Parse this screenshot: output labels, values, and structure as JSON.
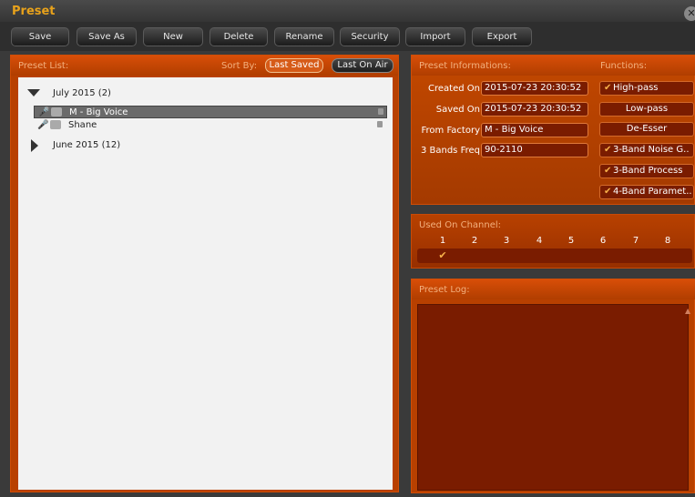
{
  "window": {
    "title": "Preset"
  },
  "toolbar": {
    "buttons": [
      "Save",
      "Save As",
      "New",
      "Delete",
      "Rename",
      "Security",
      "Import",
      "Export"
    ]
  },
  "preset_list": {
    "label": "Preset List:",
    "sort_label": "Sort By:",
    "sort_options": [
      "Last Saved",
      "Last On Air"
    ],
    "groups": [
      {
        "label": "July 2015 (2)",
        "expanded": true,
        "items": [
          {
            "name": "M - Big Voice",
            "selected": true
          },
          {
            "name": "Shane",
            "selected": false
          }
        ]
      },
      {
        "label": "June 2015 (12)",
        "expanded": false,
        "items": []
      }
    ]
  },
  "info": {
    "label": "Preset Informations:",
    "fields": [
      {
        "label": "Created On",
        "value": "2015-07-23 20:30:52"
      },
      {
        "label": "Saved On",
        "value": "2015-07-23 20:30:52"
      },
      {
        "label": "From Factory",
        "value": "M - Big Voice"
      },
      {
        "label": "3 Bands Freq",
        "value": "90-2110"
      }
    ]
  },
  "functions": {
    "label": "Functions:",
    "items": [
      {
        "label": "High-pass",
        "checked": true
      },
      {
        "label": "Low-pass",
        "checked": false
      },
      {
        "label": "De-Esser",
        "checked": false
      },
      {
        "label": "3-Band Noise G..",
        "checked": true
      },
      {
        "label": "3-Band Process",
        "checked": true
      },
      {
        "label": "4-Band Paramet..",
        "checked": true
      }
    ]
  },
  "channels": {
    "label": "Used On Channel:",
    "numbers": [
      "1",
      "2",
      "3",
      "4",
      "5",
      "6",
      "7",
      "8"
    ],
    "used": [
      true,
      false,
      false,
      false,
      false,
      false,
      false,
      false
    ]
  },
  "log": {
    "label": "Preset Log:"
  },
  "colors": {
    "accent": "#e8a21b",
    "panel": "#b84000",
    "field": "#7a1c00"
  }
}
